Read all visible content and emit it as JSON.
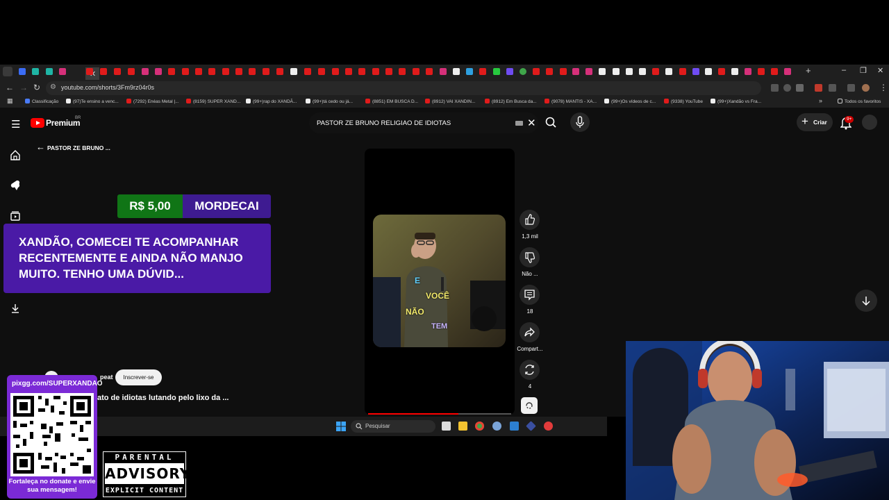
{
  "browser": {
    "url": "youtube.com/shorts/3Fm9rz04r0s",
    "all_bookmarks_label": "Todos os favoritos",
    "bookmarks": [
      "Classificação",
      "(97)Te ensino a venc...",
      "(7292) Enéas Metal |...",
      "(8159) SUPER XAND...",
      "(99+)rap do XANDÃ...",
      "(99+)tá cedo ou já...",
      "(8851) EM BUSCA D...",
      "(8912) VAI XANDIN...",
      "(8912) Em Busca da...",
      "(9078) MANTIS - XA...",
      "(99+)Os vídeos de c...",
      "(9338) YouTube",
      "(99+)Xandão vs Fra..."
    ]
  },
  "youtube": {
    "logo_text": "Premium",
    "logo_region": "BR",
    "search_query": "PASTOR ZE BRUNO RELIGIAO DE IDIOTAS",
    "create_label": "Criar",
    "notification_count": "9+",
    "back_title": "PASTOR ZE BRUNO ...",
    "actions": {
      "likes": "1,3 mil",
      "dislike": "Não ...",
      "comments": "18",
      "share": "Compart...",
      "remix": "4"
    },
    "channel_name": "peat",
    "subscribe_label": "Inscrever-se",
    "video_title": "ato de idiotas lutando pelo lixo da ...",
    "captions": [
      "E",
      "VOCÊ",
      "NÃO",
      "TEM"
    ],
    "progress_fraction": 0.63
  },
  "superchat": {
    "amount": "R$ 5,00",
    "name": "MORDECAI",
    "message": "XANDÃO, COMECEI TE ACOMPANHAR RECENTEMENTE E AINDA NÃO MANJO MUITO. TENHO UMA DÚVID..."
  },
  "taskbar": {
    "search_label": "Pesquisar"
  },
  "overlay": {
    "donate_url": "pixgg.com/SUPERXANDAO",
    "donate_note": "Fortaleça no donate e envie sua mensagem!",
    "parental_top": "PARENTAL",
    "parental_mid": "ADVISORY",
    "parental_bot": "EXPLICIT CONTENT"
  },
  "colors": {
    "youtube_red": "#ff0000",
    "superchat_green": "#107516",
    "superchat_purple": "#4a1aa6",
    "donate_purple": "#7b2ad6"
  }
}
